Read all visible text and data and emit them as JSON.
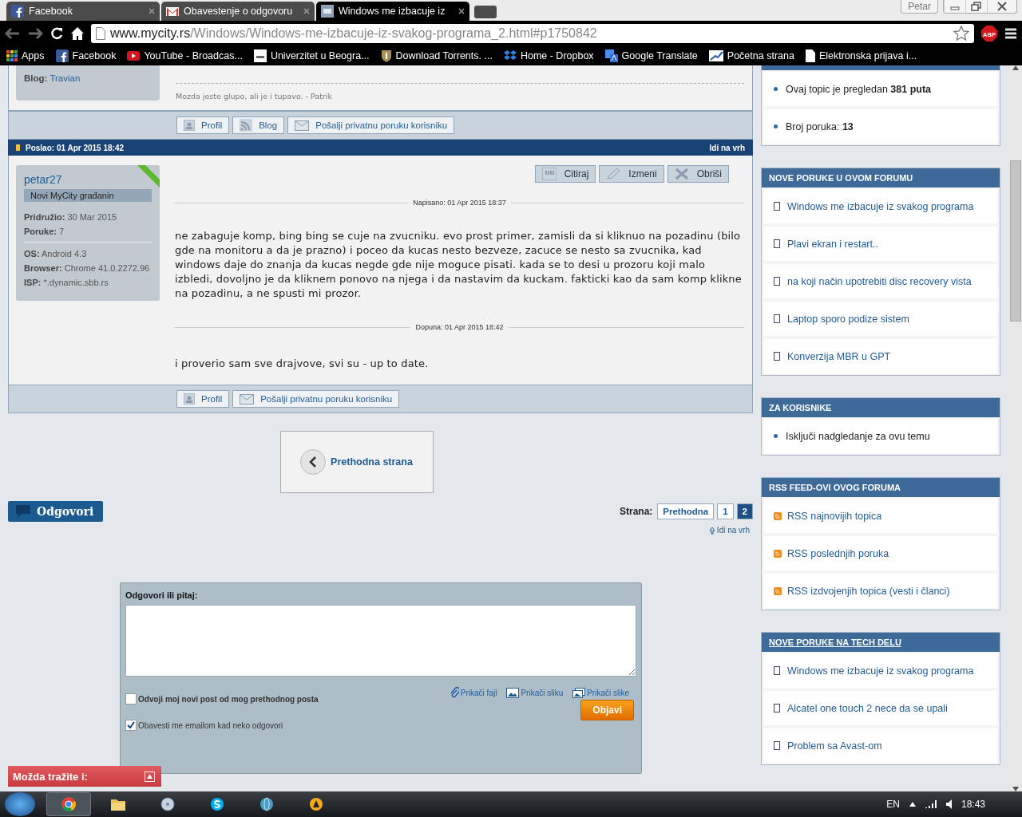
{
  "browser": {
    "tabs": [
      {
        "title": "Facebook",
        "selected": false
      },
      {
        "title": "Obavestenje o odgovoru",
        "selected": false
      },
      {
        "title": "Windows me izbacuje iz",
        "selected": true
      }
    ],
    "profile": "Petar",
    "url_host": "www.mycity.rs",
    "url_path": "/Windows/Windows-me-izbacuje-iz-svakog-programa_2.html#p1750842",
    "adblock": "ABP",
    "bookmarks": [
      "Apps",
      "Facebook",
      "YouTube - Broadcas...",
      "Univerzitet u Beogra...",
      "Download Torrents. ...",
      "Home - Dropbox",
      "Google Translate",
      "Početna strana",
      "Elektronska prijava i..."
    ]
  },
  "previous_post": {
    "blog_label": "Blog:",
    "blog_link": "Travian",
    "signature": "Mozda jeste glupo, ali je i tupavo. - Patrik",
    "buttons": [
      "Profil",
      "Blog",
      "Pošalji privatnu poruku korisniku"
    ]
  },
  "post": {
    "posted": "Poslao: 01 Apr 2015 18:42",
    "top_link": "Idi na vrh",
    "author": "petar27",
    "rank": "Novi MyCity građanin",
    "stats": [
      {
        "label": "Pridružio:",
        "value": "30 Mar 2015"
      },
      {
        "label": "Poruke:",
        "value": "7"
      }
    ],
    "device": [
      {
        "label": "OS:",
        "value": "Android 4.3"
      },
      {
        "label": "Browser:",
        "value": "Chrome 41.0.2272.96"
      },
      {
        "label": "ISP:",
        "value": "*.dynamic.sbb.rs"
      }
    ],
    "actions": [
      "Citiraj",
      "Izmeni",
      "Obriši"
    ],
    "written": "Napisano: 01 Apr 2015 18:37",
    "body": "ne zabaguje komp, bing bing se cuje na zvucniku. evo prost primer, zamisli da si kliknuo na pozadinu (bilo gde na monitoru a da je prazno) i poceo da kucas nesto bezveze, zacuce se nesto sa zvucnika, kad windows daje do znanja da kucas negde gde nije moguce pisati. kada se to desi u prozoru koji malo izbledi, dovoljno je da kliknem ponovo na njega i da nastavim da kuckam. fakticki kao da sam komp klikne na pozadinu, a ne spusti mi prozor.",
    "addendum": "Dopuna: 01 Apr 2015 18:42",
    "addendum_body": "i proverio sam sve drajvove, svi su - up to date.",
    "buttons": [
      "Profil",
      "Pošalji privatnu poruku korisniku"
    ]
  },
  "previous_page": "Prethodna strana",
  "reply_button": "Odgovori",
  "pagination": {
    "label": "Strana:",
    "pages": [
      {
        "label": "Prethodna",
        "selected": false
      },
      {
        "label": "1",
        "selected": false
      },
      {
        "label": "2",
        "selected": true
      }
    ],
    "top_link": "Idi na vrh"
  },
  "reply_form": {
    "label": "Odgovori ili pitaj:",
    "attachments": [
      "Prikači fajl",
      "Prikači sliku",
      "Prikači slike"
    ],
    "options": [
      {
        "label": "Odvoji moj novi post od mog prethodnog posta",
        "checked": false
      },
      {
        "label": "Obavesti me emailom kad neko odgovori",
        "checked": true
      }
    ],
    "submit": "Objavi"
  },
  "suggestions_popup": "Možda tražite i:",
  "sidebar": [
    {
      "kind": "bullet",
      "items": [
        "Ovaj topic je pregledan **381 puta**",
        "Broj poruka: **13**"
      ]
    },
    {
      "title": "NOVE PORUKE U OVOM FORUMU",
      "kind": "doc",
      "items": [
        "Windows me izbacuje iz svakog programa",
        "Plavi ekran i restart..",
        "na koji način upotrebiti disc recovery vista",
        "Laptop sporo podize sistem",
        "Konverzija MBR u GPT"
      ]
    },
    {
      "title": "ZA KORISNIKE",
      "kind": "bullet",
      "items": [
        "Isključi nadgledanje za ovu temu"
      ]
    },
    {
      "title": "RSS FEED-OVI OVOG FORUMA",
      "kind": "rss",
      "items": [
        "RSS najnovijih topica",
        "RSS poslednjih poruka",
        "RSS izdvojenjih topica (vesti i članci)"
      ]
    },
    {
      "title": "NOVE PORUKE NA TECH DELU",
      "kind": "doc",
      "link": true,
      "items": [
        "Windows me izbacuje iz svakog programa",
        "Alcatel one touch 2 nece da se upali",
        "Problem sa Avast-om"
      ]
    }
  ],
  "taskbar": {
    "language": "EN",
    "clock": "18:43"
  }
}
